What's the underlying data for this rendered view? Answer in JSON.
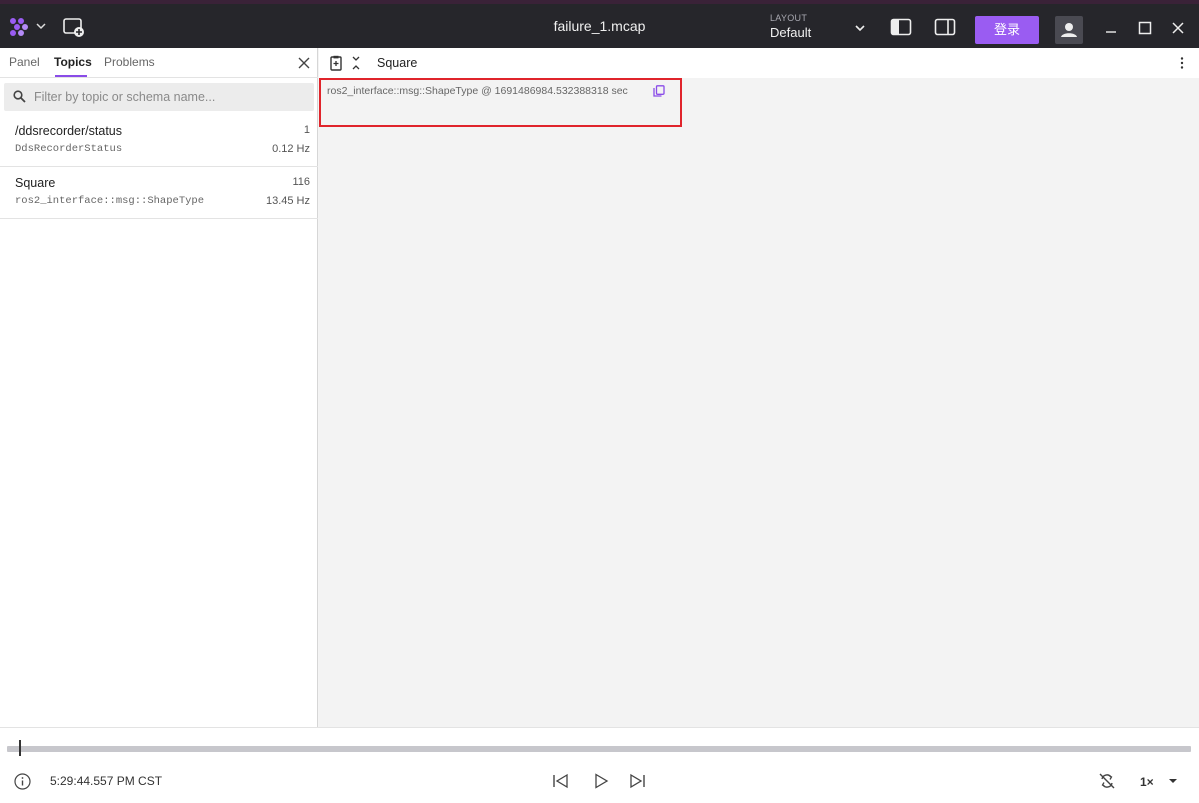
{
  "app": {
    "window_title": "failure_1.mcap",
    "layout_label": "LAYOUT",
    "layout_value": "Default",
    "login_label": "登录"
  },
  "sidebar": {
    "tabs": [
      {
        "label": "Panel",
        "active": false
      },
      {
        "label": "Topics",
        "active": true
      },
      {
        "label": "Problems",
        "active": false
      }
    ],
    "filter_placeholder": "Filter by topic or schema name...",
    "topics": [
      {
        "name": "/ddsrecorder/status",
        "count": "1",
        "schema": "DdsRecorderStatus",
        "rate": "0.12 Hz"
      },
      {
        "name": "Square",
        "count": "116",
        "schema": "ros2_interface::msg::ShapeType",
        "rate": "13.45 Hz"
      }
    ]
  },
  "panel": {
    "topic": "Square",
    "message_header": "ros2_interface::msg::ShapeType @ 1691486984.532388318 sec"
  },
  "playback": {
    "current_time": "5:29:44.557 PM CST",
    "speed": "1×"
  },
  "colors": {
    "accent": "#9a5cf2",
    "topbar": "#26262b",
    "highlight": "#e0242b"
  }
}
